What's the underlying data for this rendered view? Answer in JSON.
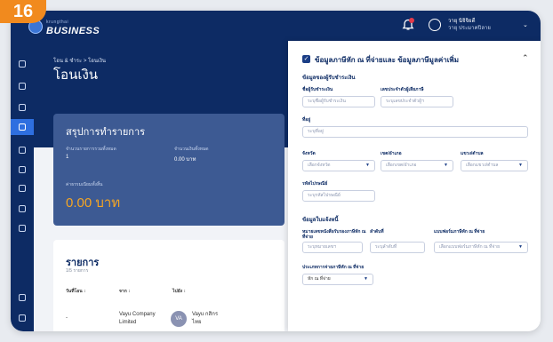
{
  "badge": "16",
  "app": {
    "logo_top": "krungthai",
    "logo_text": "BUSINESS",
    "user_name": "วายุ นิจิจิยดี",
    "user_sub": "วายุ ประมาคปิลาย"
  },
  "colors": {
    "navy": "#0d2b64",
    "accent": "#2e6fe0",
    "amount": "#f6a623",
    "badge": "#f18a1e"
  },
  "icons": [
    "home-icon",
    "calendar-icon",
    "card-icon",
    "transfer-icon",
    "folder-icon",
    "chart-icon",
    "document-icon",
    "users-icon",
    "settings-icon",
    "help-icon",
    "logout-icon"
  ],
  "page": {
    "breadcrumb": "โอน & ชำระ > โอนเงิน",
    "title": "โอนเงิน"
  },
  "summary": {
    "title": "สรุปการทำรายการ",
    "count_label": "จำนวนรายการรวมทั้งหมด",
    "count_value": "1",
    "total_label": "จำนวนเงินทั้งหมด",
    "total_value": "0.00 บาท",
    "fee_label": "ค่าธรรมเนียมทั้งสิ้น",
    "fee_value": "0.00 บาท"
  },
  "list": {
    "title": "รายการ",
    "count": "1/5 รายการ",
    "columns": [
      "วันที่โอน ↕",
      "จาก ↕",
      "ไปยัง ↕"
    ],
    "row": {
      "date": "-",
      "from": "Vayu Company Limited",
      "to_initials": "VA",
      "to_name": "Vayu กสิกรไทย"
    }
  },
  "panel": {
    "title": "ข้อมูลภาษีหัก ณ ที่จ่ายและ ข้อมูลภาษีมูลค่าเพิ่ม",
    "sec_payee": "ข้อมูลของผู้รับชำระเงิน",
    "name_label": "ชื่อผู้รับชำระเงิน",
    "name_ph": "ระบุชื่อผู้รับชำระเงิน",
    "taxid_label": "เลขประจำตัวผู้เสียภาษี",
    "taxid_ph": "ระบุเลขประจำตัวผู้ฯ",
    "addr_label": "ที่อยู่",
    "addr_ph": "ระบุที่อยู่",
    "province_label": "จังหวัด",
    "province_ph": "เลือกจังหวัด",
    "district_label": "เขต/อำเภอ",
    "district_ph": "เลือกเขต/อำเภอ",
    "subdistrict_label": "แขวง/ตำบล",
    "subdistrict_ph": "เลือกแขวง/ตำบล",
    "zip_label": "รหัสไปรษณีย์",
    "zip_ph": "ระบุรหัสไปรษณีย์",
    "sec_doc": "ข้อมูลใบแจ้งหนี้",
    "docno_label": "หมายเลขหนังสือรับรองภาษีหัก ณ ที่จ่าย",
    "docno_ph": "ระบุหมายเลขฯ",
    "seq_label": "ลำดับที่",
    "seq_ph": "ระบุลำดับที่",
    "form_label": "แบบฟอร์มภาษีหัก ณ ที่จ่าย",
    "form_ph": "เลือกแบบฟอร์มภาษีหัก ณ ที่จ่าย",
    "type_label": "ประเภทการจ่ายภาษีหัก ณ ที่จ่าย",
    "type_value": "หัก ณ ที่จ่าย"
  }
}
